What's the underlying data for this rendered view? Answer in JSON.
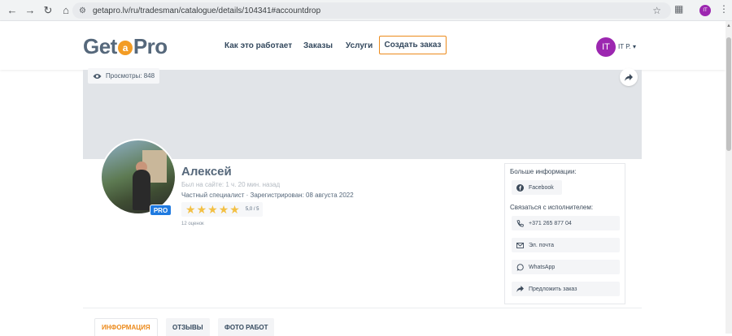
{
  "browser": {
    "url": "getapro.lv/ru/tradesman/catalogue/details/104341#accountdrop",
    "profile_initials": "IT"
  },
  "header": {
    "logo_left": "Get",
    "logo_mid": "a",
    "logo_right": "Pro",
    "nav": [
      "Как это работает",
      "Заказы",
      "Услуги"
    ],
    "cta": "Создать заказ",
    "user_initials": "IT",
    "user_name": "IT P. ▾"
  },
  "profile": {
    "views": "Просмотры: 848",
    "name": "Алексей",
    "last_seen": "Был на сайте: 1 ч. 20 мин. назад",
    "meta": "Частный специалист · Зарегистрирован: 08 августа 2022",
    "rating_value": "5,0 / 5",
    "rating_stars": 5,
    "reviews_count": "12 оценок",
    "badge": "PRO"
  },
  "panel": {
    "more_info_heading": "Больше информации:",
    "facebook": "Facebook",
    "contact_heading": "Связаться с исполнителем:",
    "phone": "+371 265 877 04",
    "email": "Эл. почта",
    "whatsapp": "WhatsApp",
    "offer": "Предложить заказ"
  },
  "tabs": [
    "ИНФОРМАЦИЯ",
    "ОТЗЫВЫ",
    "ФОТО РАБОТ"
  ],
  "colors": {
    "accent": "#ec8a1b",
    "avatar": "#9c27b0",
    "pro": "#1f7ae0",
    "star": "#f3c044"
  }
}
